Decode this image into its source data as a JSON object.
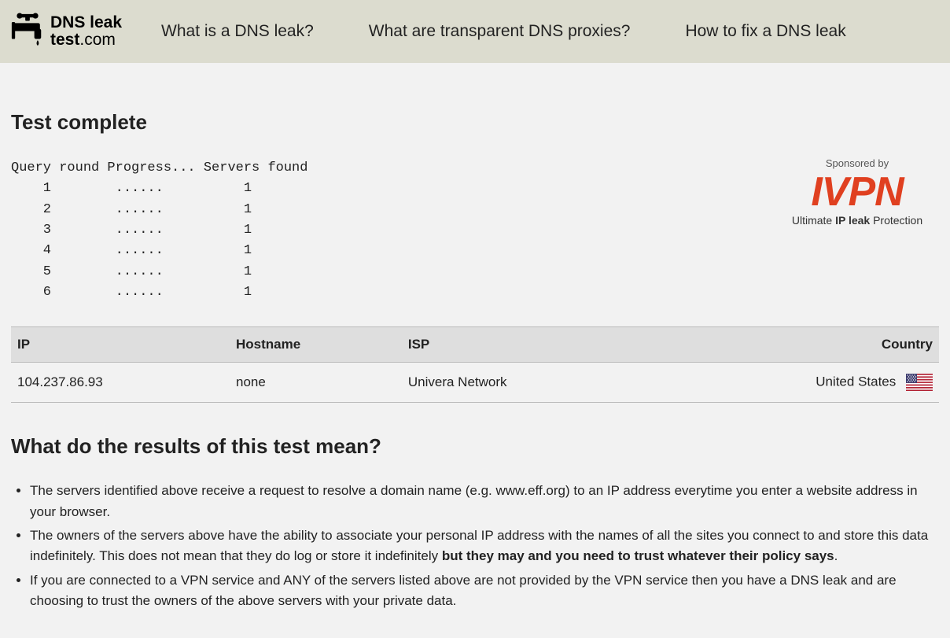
{
  "header": {
    "logo_line1": "DNS leak",
    "logo_line2": "test",
    "logo_suffix": ".com",
    "nav": [
      "What is a DNS leak?",
      "What are transparent DNS proxies?",
      "How to fix a DNS leak"
    ]
  },
  "sponsor": {
    "label": "Sponsored by",
    "brand": "IVPN",
    "tagline_prefix": "Ultimate ",
    "tagline_bold": "IP leak",
    "tagline_suffix": " Protection"
  },
  "main": {
    "title": "Test complete",
    "progress_header": "Query round Progress... Servers found",
    "rounds": [
      {
        "n": "1",
        "dots": "......",
        "found": "1"
      },
      {
        "n": "2",
        "dots": "......",
        "found": "1"
      },
      {
        "n": "3",
        "dots": "......",
        "found": "1"
      },
      {
        "n": "4",
        "dots": "......",
        "found": "1"
      },
      {
        "n": "5",
        "dots": "......",
        "found": "1"
      },
      {
        "n": "6",
        "dots": "......",
        "found": "1"
      }
    ],
    "table": {
      "cols": [
        "IP",
        "Hostname",
        "ISP",
        "Country"
      ],
      "row": {
        "ip": "104.237.86.93",
        "hostname": "none",
        "isp": "Univera Network",
        "country": "United States"
      }
    },
    "meaning_title": "What do the results of this test mean?",
    "bullets": [
      {
        "pre": "The servers identified above receive a request to resolve a domain name (e.g. www.eff.org) to an IP address everytime you enter a website address in your browser.",
        "bold": "",
        "post": ""
      },
      {
        "pre": "The owners of the servers above have the ability to associate your personal IP address with the names of all the sites you connect to and store this data indefinitely. This does not mean that they do log or store it indefinitely ",
        "bold": "but they may and you need to trust whatever their policy says",
        "post": "."
      },
      {
        "pre": "If you are connected to a VPN service and ANY of the servers listed above are not provided by the VPN service then you have a DNS leak and are choosing to trust the owners of the above servers with your private data.",
        "bold": "",
        "post": ""
      }
    ]
  }
}
